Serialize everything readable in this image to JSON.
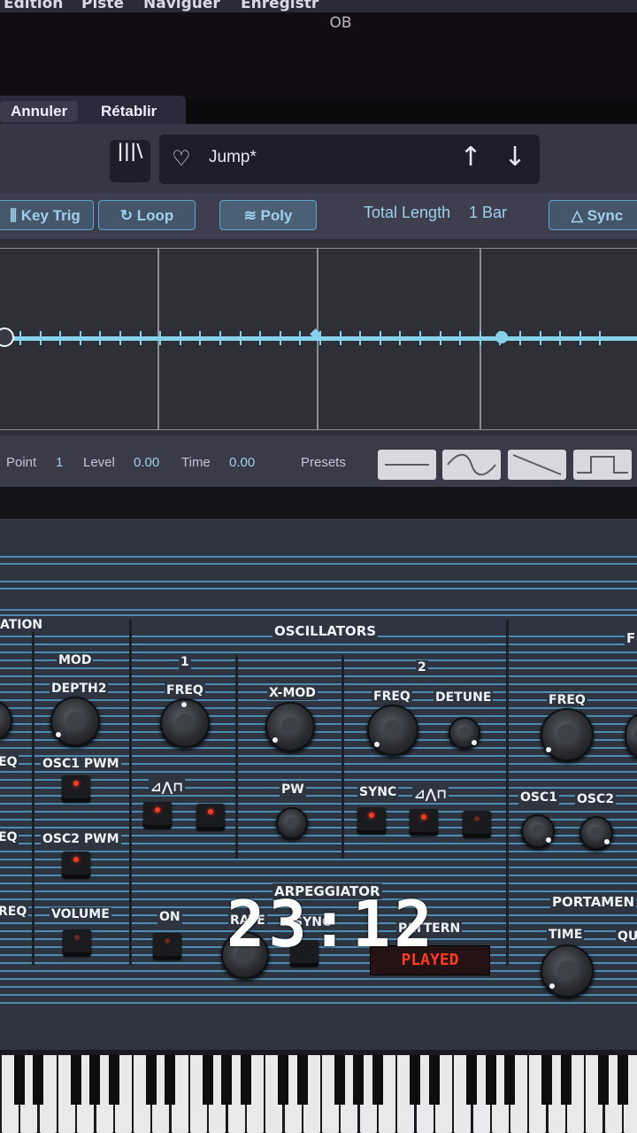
{
  "menubar": {
    "items": [
      "Édition",
      "Piste",
      "Naviguer",
      "Enregistr"
    ]
  },
  "window": {
    "title": "OB"
  },
  "editbar": {
    "undo": "Annuler",
    "redo": "Rétablir"
  },
  "preset": {
    "library_icon": "library-icon",
    "name": "Jump*",
    "favorite_icon": "heart-icon",
    "up_icon": "↑",
    "down_icon": "↓"
  },
  "modebar": {
    "key_trig": "Key Trig",
    "loop": "Loop",
    "poly": "Poly",
    "total_length_label": "Total Length",
    "total_length_value": "1 Bar",
    "sync": "Sync"
  },
  "envelope": {
    "level": 0.0,
    "points": 2
  },
  "infobar": {
    "point_label": "Point",
    "point_value": "1",
    "level_label": "Level",
    "level_value": "0.00",
    "time_label": "Time",
    "time_value": "0.00",
    "presets_label": "Presets",
    "preset_shapes": [
      "flat",
      "sine",
      "ramp-down",
      "square"
    ]
  },
  "synth": {
    "section_left": "ATION",
    "section_oscillators": "OSCILLATORS",
    "section_right": "F",
    "mod_label": "MOD",
    "osc1_label": "1",
    "osc2_label": "2",
    "depth2": "DEPTH2",
    "freq1": "FREQ",
    "xmod": "X-MOD",
    "freq2": "FREQ",
    "detune": "DETUNE",
    "freq3": "FREQ",
    "osc1_pwm": "OSC1 PWM",
    "osc2_pwm": "OSC2 PWM",
    "volume": "VOLUME",
    "left_eq1": "EQ",
    "left_eq2": "EQ",
    "left_freq": "REQ",
    "waves1": "⊿⋀⊓",
    "pw": "PW",
    "sync": "SYNC",
    "waves2": "⊿⋀⊓",
    "osc1_right": "OSC1",
    "osc2_right": "OSC2",
    "arpeggiator": "ARPEGGIATOR",
    "on": "ON",
    "rate": "RATE",
    "sync_arp": "SYNC",
    "pattern": "PATTERN",
    "pattern_value": "PLAYED",
    "portamento": "PORTAMEN",
    "time": "TIME",
    "quick": "QU"
  },
  "overlay": {
    "clock": "23:12"
  }
}
